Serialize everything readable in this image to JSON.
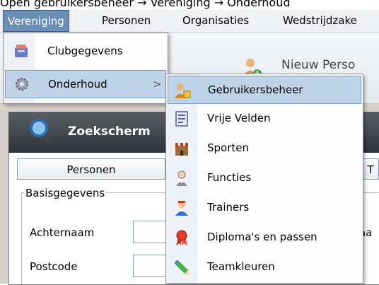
{
  "caption": "Open gebruikersbeheer → Vereniging → Onderhoud",
  "menubar": {
    "items": [
      {
        "label": "Vereniging"
      },
      {
        "label": "Personen"
      },
      {
        "label": "Organisaties"
      },
      {
        "label": "Wedstrijdzake"
      }
    ]
  },
  "toolbar": {
    "new_person_label": "Nieuw Perso"
  },
  "panel": {
    "title": "Zoekscherm",
    "tabs": [
      {
        "label": "Personen"
      },
      {
        "label": "T"
      }
    ],
    "group_label": "Basisgegevens",
    "fields": [
      {
        "label": "Achternaam",
        "tail": "aa"
      },
      {
        "label": "Postcode"
      }
    ]
  },
  "vereniging_menu": {
    "items": [
      {
        "label": "Clubgegevens",
        "icon": "database-icon"
      },
      {
        "label": "Onderhoud",
        "icon": "gear-icon",
        "submenu_arrow": ">"
      }
    ]
  },
  "onderhoud_menu": {
    "items": [
      {
        "label": "Gebruikersbeheer",
        "icon": "users-lock-icon"
      },
      {
        "label": "Vrije Velden",
        "icon": "form-icon"
      },
      {
        "label": "Sporten",
        "icon": "castle-icon"
      },
      {
        "label": "Functies",
        "icon": "person-suit-icon"
      },
      {
        "label": "Trainers",
        "icon": "trainer-icon"
      },
      {
        "label": "Diploma's en passen",
        "icon": "ribbon-icon"
      },
      {
        "label": "Teamkleuren",
        "icon": "pencil-icon"
      }
    ]
  },
  "colors": {
    "menu_active": "#6b8fb4",
    "menu_highlight": "#bfd3e8"
  }
}
